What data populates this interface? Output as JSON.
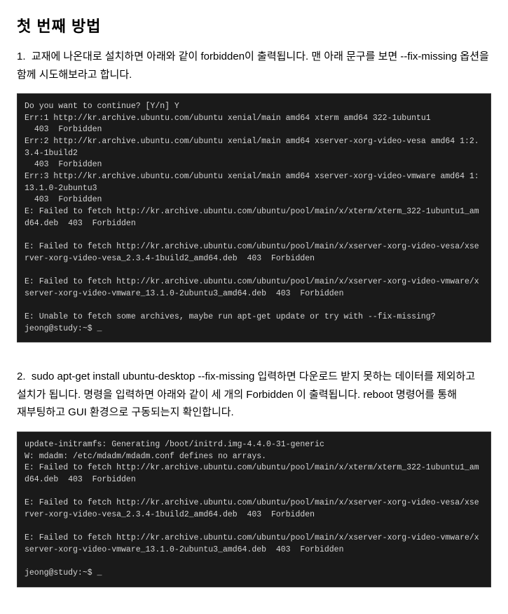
{
  "page": {
    "title": "첫 번째 방법",
    "step1": {
      "label": "1.",
      "text": "교재에 나온대로 설치하면 아래와 같이 forbidden이 출력됩니다. 맨 아래 문구를 보면 --fix-missing 옵션을 함께 시도해보라고 합니다."
    },
    "terminal1": {
      "lines": [
        "Do you want to continue? [Y/n] Y",
        "Err:1 http://kr.archive.ubuntu.com/ubuntu xenial/main amd64 xterm amd64 322-1ubuntu1",
        "  403  Forbidden",
        "Err:2 http://kr.archive.ubuntu.com/ubuntu xenial/main amd64 xserver-xorg-video-vesa amd64 1:2.3.4-1build2",
        "  403  Forbidden",
        "Err:3 http://kr.archive.ubuntu.com/ubuntu xenial/main amd64 xserver-xorg-video-vmware amd64 1:13.1.0-2ubuntu3",
        "  403  Forbidden",
        "E: Failed to fetch http://kr.archive.ubuntu.com/ubuntu/pool/main/x/xterm/xterm_322-1ubuntu1_amd64.deb  403  Forbidden",
        "",
        "E: Failed to fetch http://kr.archive.ubuntu.com/ubuntu/pool/main/x/xserver-xorg-video-vesa/xserver-xorg-video-vesa_2.3.4-1build2_amd64.deb  403  Forbidden",
        "",
        "E: Failed to fetch http://kr.archive.ubuntu.com/ubuntu/pool/main/x/xserver-xorg-video-vmware/xserver-xorg-video-vmware_13.1.0-2ubuntu3_amd64.deb  403  Forbidden",
        "",
        "E: Unable to fetch some archives, maybe run apt-get update or try with --fix-missing?",
        "jeong@study:~$ _"
      ]
    },
    "step2": {
      "label": "2.",
      "text": "sudo apt-get install ubuntu-desktop --fix-missing 입력하면 다운로드 받지 못하는 데이터를 제외하고 설치가 됩니다. 명령을 입력하면 아래와 같이 세 개의 Forbidden 이 출력됩니다. reboot 명령어를 통해 재부팅하고 GUI 환경으로 구동되는지 확인합니다."
    },
    "terminal2": {
      "lines": [
        "update-initramfs: Generating /boot/initrd.img-4.4.0-31-generic",
        "W: mdadm: /etc/mdadm/mdadm.conf defines no arrays.",
        "E: Failed to fetch http://kr.archive.ubuntu.com/ubuntu/pool/main/x/xterm/xterm_322-1ubuntu1_amd64.deb  403  Forbidden",
        "",
        "E: Failed to fetch http://kr.archive.ubuntu.com/ubuntu/pool/main/x/xserver-xorg-video-vesa/xserver-xorg-video-vesa_2.3.4-1build2_amd64.deb  403  Forbidden",
        "",
        "E: Failed to fetch http://kr.archive.ubuntu.com/ubuntu/pool/main/x/xserver-xorg-video-vmware/xserver-xorg-video-vmware_13.1.0-2ubuntu3_amd64.deb  403  Forbidden",
        "",
        "jeong@study:~$ _"
      ]
    }
  }
}
